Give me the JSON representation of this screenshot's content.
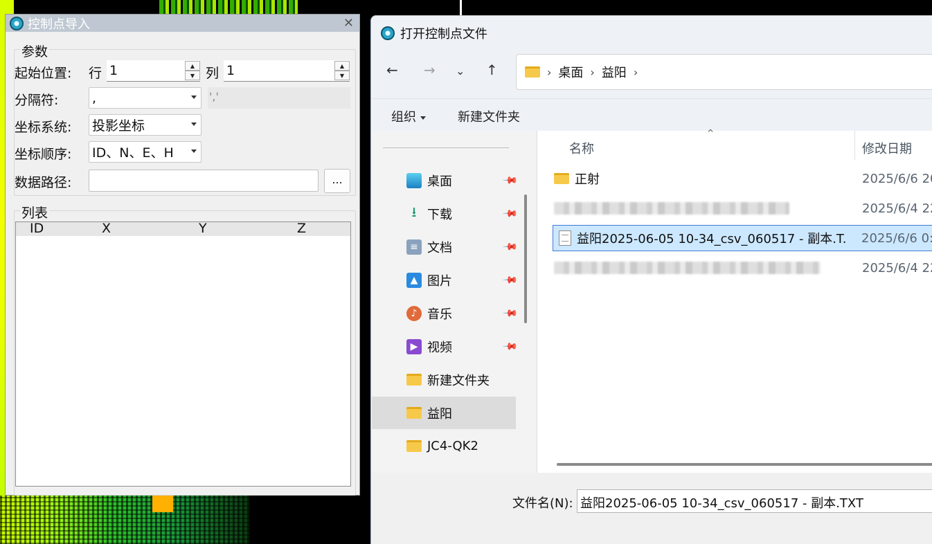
{
  "import_dialog": {
    "title": "控制点导入",
    "close_glyph": "✕",
    "params": {
      "group_title": "参数",
      "start_pos_label": "起始位置:",
      "row_label": "行",
      "row_value": "1",
      "col_label": "列",
      "col_value": "1",
      "separator_label": "分隔符:",
      "separator_value": ",",
      "separator_preview": "','",
      "coord_system_label": "坐标系统:",
      "coord_system_value": "投影坐标",
      "coord_order_label": "坐标顺序:",
      "coord_order_value": "ID、N、E、H",
      "data_path_label": "数据路径:",
      "data_path_value": "",
      "browse_label": "..."
    },
    "list": {
      "group_title": "列表",
      "columns": [
        "ID",
        "X",
        "Y",
        "Z"
      ]
    }
  },
  "file_dialog": {
    "title": "打开控制点文件",
    "breadcrumb": [
      "桌面",
      "益阳"
    ],
    "toolbar": {
      "organize_label": "组织",
      "new_folder_label": "新建文件夹"
    },
    "nav_items": [
      {
        "label": "桌面",
        "icon": "desktop-icon",
        "pinned": true
      },
      {
        "label": "下载",
        "icon": "download-icon",
        "pinned": true
      },
      {
        "label": "文档",
        "icon": "document-icon",
        "pinned": true
      },
      {
        "label": "图片",
        "icon": "pictures-icon",
        "pinned": true
      },
      {
        "label": "音乐",
        "icon": "music-icon",
        "pinned": true
      },
      {
        "label": "视频",
        "icon": "video-icon",
        "pinned": true
      },
      {
        "label": "新建文件夹",
        "icon": "folder-icon",
        "pinned": false
      },
      {
        "label": "益阳",
        "icon": "folder-icon",
        "pinned": false,
        "selected": true
      },
      {
        "label": "JC4-QK2",
        "icon": "folder-icon",
        "pinned": false
      }
    ],
    "columns": {
      "name": "名称",
      "modified": "修改日期"
    },
    "files": [
      {
        "name": "正射",
        "type": "folder",
        "modified": "2025/6/6 20"
      },
      {
        "name": "",
        "type": "file",
        "modified": "2025/6/4 22",
        "blurred": true
      },
      {
        "name": "益阳2025-06-05 10-34_csv_060517 - 副本.T...",
        "type": "file",
        "modified": "2025/6/6 0:",
        "selected": true
      },
      {
        "name": "",
        "type": "file",
        "modified": "2025/6/4 22",
        "blurred": true
      }
    ],
    "filename_label": "文件名(N):",
    "filename_value": "益阳2025-06-05 10-34_csv_060517 - 副本.TXT"
  },
  "colors": {
    "title_bar": "#bfc8d2",
    "selection": "#cce8ff",
    "selection_border": "#3b7bd6",
    "folder": "#f7c94a"
  }
}
